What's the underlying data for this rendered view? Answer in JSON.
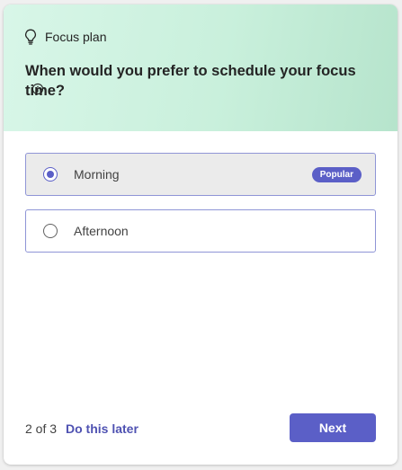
{
  "header": {
    "eyebrow_icon": "lightbulb-icon",
    "eyebrow_label": "Focus plan",
    "question": "When would you prefer to schedule your focus time?",
    "info_icon": "info-icon"
  },
  "options": [
    {
      "label": "Morning",
      "selected": true,
      "badge": "Popular"
    },
    {
      "label": "Afternoon",
      "selected": false
    }
  ],
  "footer": {
    "progress": "2 of 3",
    "later_label": "Do this later",
    "next_label": "Next"
  },
  "colors": {
    "accent": "#5b5fc7",
    "link": "#4f52b2",
    "header_gradient_start": "#d8f6e8",
    "header_gradient_end": "#b6e4cc"
  }
}
